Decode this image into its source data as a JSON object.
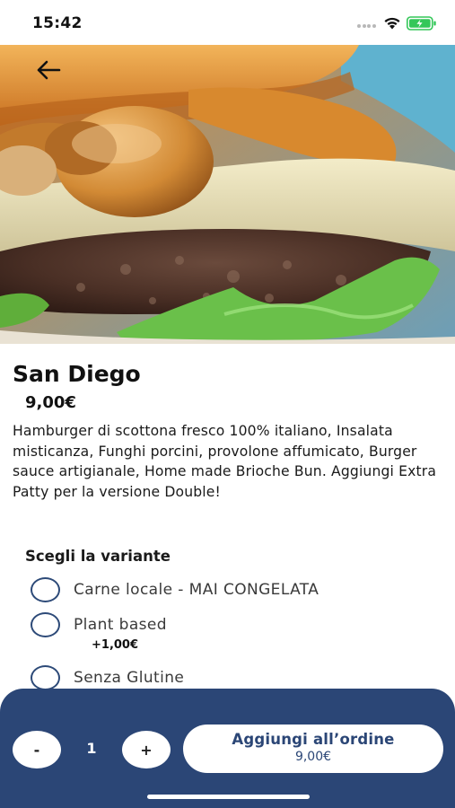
{
  "status_bar": {
    "time": "15:42",
    "icons": [
      "signal-dots-icon",
      "wifi-icon",
      "battery-charging-icon"
    ],
    "battery_color": "#34c759"
  },
  "hero": {
    "image": "burger-photo",
    "back_icon": "arrow-left-icon"
  },
  "product": {
    "title": "San Diego",
    "price": "9,00€",
    "description": "Hamburger di scottona fresco 100% italiano, Insalata misticanza, Funghi porcini, provolone affumicato, Burger sauce artigianale, Home made Brioche Bun. Aggiungi Extra Patty per la versione Double!"
  },
  "variants": {
    "heading": "Scegli la variante",
    "options": [
      {
        "label": "Carne locale - MAI CONGELATA",
        "selected": false
      },
      {
        "label": "Plant based",
        "extra": "+1,00€",
        "selected": false
      },
      {
        "label": "Senza Glutine",
        "selected": false
      }
    ]
  },
  "order_bar": {
    "minus_label": "-",
    "quantity": "1",
    "plus_label": "+",
    "add_label": "Aggiungi all’ordine",
    "total": "9,00€",
    "accent_color": "#2b4676"
  }
}
